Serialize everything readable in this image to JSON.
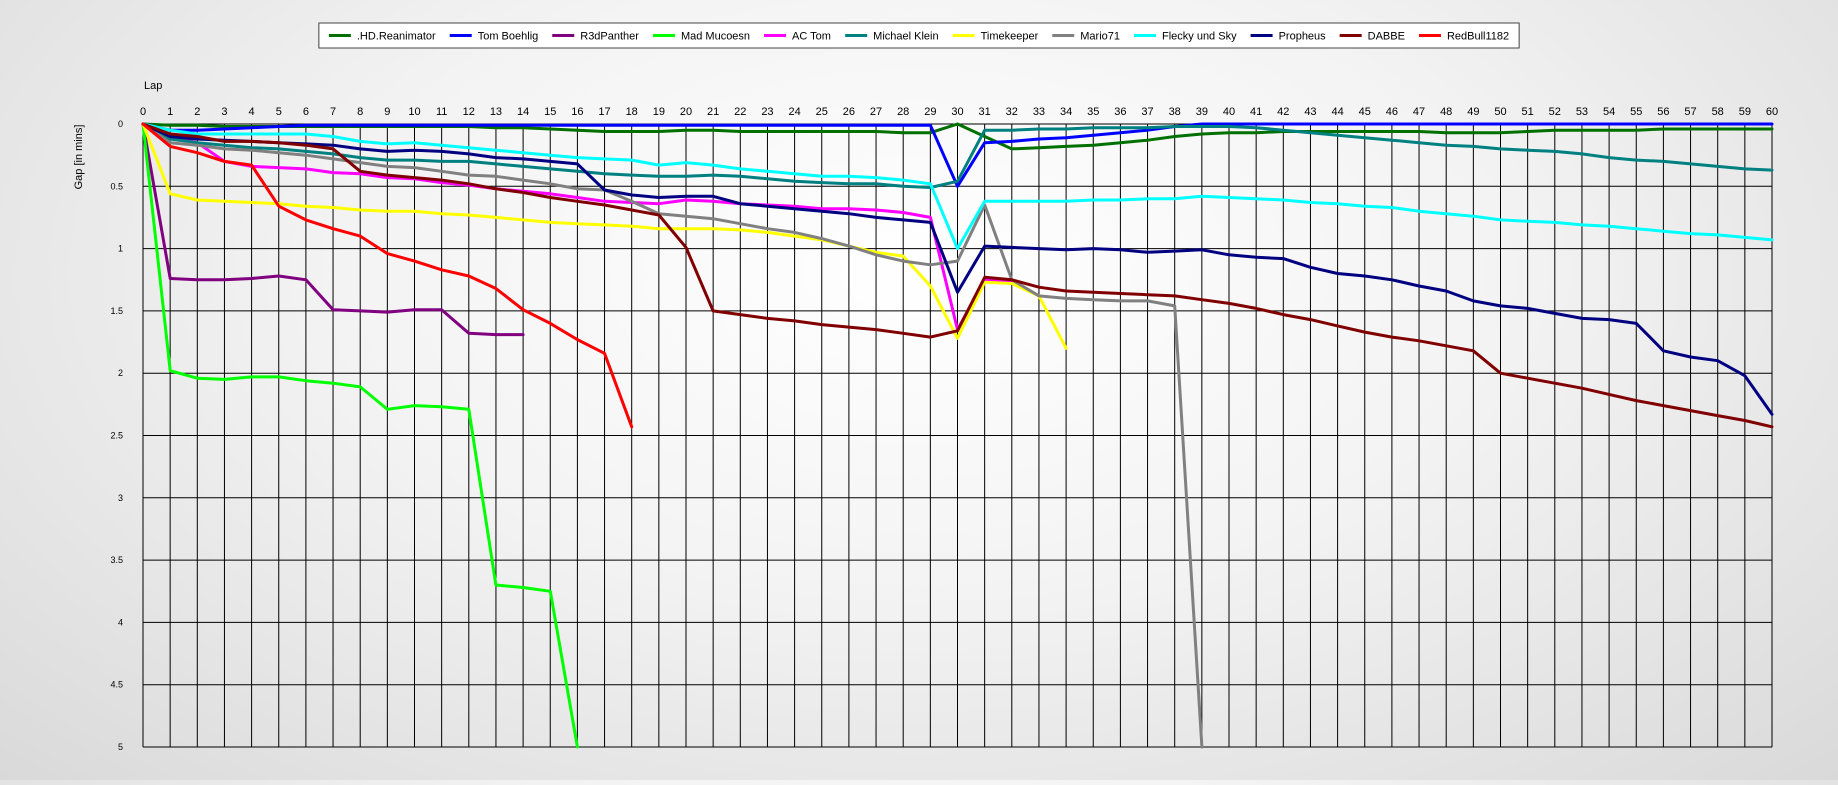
{
  "chart_data": {
    "type": "line",
    "title": "",
    "xlabel": "Lap",
    "ylabel": "Gap [in mins]",
    "x": [
      0,
      1,
      2,
      3,
      4,
      5,
      6,
      7,
      8,
      9,
      10,
      11,
      12,
      13,
      14,
      15,
      16,
      17,
      18,
      19,
      20,
      21,
      22,
      23,
      24,
      25,
      26,
      27,
      28,
      29,
      30,
      31,
      32,
      33,
      34,
      35,
      36,
      37,
      38,
      39,
      40,
      41,
      42,
      43,
      44,
      45,
      46,
      47,
      48,
      49,
      50,
      51,
      52,
      53,
      54,
      55,
      56,
      57,
      58,
      59,
      60
    ],
    "xlim": [
      0,
      60
    ],
    "ylim": [
      0,
      5
    ],
    "y_inverted": true,
    "yticks": [
      0,
      0.5,
      1,
      1.5,
      2,
      2.5,
      3,
      3.5,
      4,
      4.5,
      5
    ],
    "ytick_labels": [
      "0",
      "0.5",
      "1",
      "1.5",
      "2",
      "2.5",
      "3",
      "3.5",
      "4",
      "4.5",
      "5"
    ],
    "grid": true,
    "legend_position": "top-center",
    "series": [
      {
        "name": ".HD.Reanimator",
        "color": "#007000",
        "values": [
          0,
          0.01,
          0.01,
          0.02,
          0.02,
          0.02,
          0.02,
          0.02,
          0.02,
          0.02,
          0.02,
          0.02,
          0.02,
          0.03,
          0.03,
          0.04,
          0.05,
          0.06,
          0.06,
          0.06,
          0.05,
          0.05,
          0.06,
          0.06,
          0.06,
          0.06,
          0.06,
          0.06,
          0.07,
          0.07,
          0,
          0.1,
          0.2,
          0.19,
          0.18,
          0.17,
          0.15,
          0.13,
          0.1,
          0.08,
          0.07,
          0.07,
          0.06,
          0.06,
          0.06,
          0.06,
          0.06,
          0.06,
          0.07,
          0.07,
          0.07,
          0.06,
          0.05,
          0.05,
          0.05,
          0.05,
          0.04,
          0.04,
          0.04,
          0.04,
          0.04
        ]
      },
      {
        "name": "Tom Boehlig",
        "color": "#0000ff",
        "values": [
          0,
          0.05,
          0.05,
          0.04,
          0.03,
          0.02,
          0.01,
          0.01,
          0.01,
          0.01,
          0.01,
          0.01,
          0.01,
          0.01,
          0.01,
          0.01,
          0.01,
          0.01,
          0.01,
          0.01,
          0.01,
          0.01,
          0.01,
          0.01,
          0.01,
          0.01,
          0.01,
          0.01,
          0.01,
          0.01,
          0.5,
          0.15,
          0.14,
          0.12,
          0.11,
          0.09,
          0.07,
          0.05,
          0.02,
          0,
          0,
          0,
          0,
          0,
          0,
          0,
          0,
          0,
          0,
          0,
          0,
          0,
          0,
          0,
          0,
          0,
          0,
          0,
          0,
          0,
          0
        ]
      },
      {
        "name": "R3dPanther",
        "color": "#800080",
        "values": [
          0,
          1.24,
          1.25,
          1.25,
          1.24,
          1.22,
          1.25,
          1.49,
          1.5,
          1.51,
          1.49,
          1.49,
          1.68,
          1.69,
          1.69
        ]
      },
      {
        "name": "Mad Mucoesn",
        "color": "#00ff00",
        "values": [
          0,
          1.98,
          2.04,
          2.05,
          2.03,
          2.03,
          2.06,
          2.08,
          2.11,
          2.29,
          2.26,
          2.27,
          2.29,
          3.7,
          3.72,
          3.75,
          5
        ]
      },
      {
        "name": "AC Tom",
        "color": "#ff00ff",
        "values": [
          0,
          0.1,
          0.15,
          0.3,
          0.34,
          0.35,
          0.36,
          0.39,
          0.4,
          0.43,
          0.44,
          0.47,
          0.49,
          0.52,
          0.54,
          0.56,
          0.59,
          0.62,
          0.63,
          0.64,
          0.61,
          0.62,
          0.64,
          0.65,
          0.66,
          0.68,
          0.68,
          0.69,
          0.71,
          0.75,
          1.65,
          1.25,
          1.27
        ]
      },
      {
        "name": "Michael Klein",
        "color": "#008080",
        "values": [
          0,
          0.12,
          0.15,
          0.17,
          0.19,
          0.2,
          0.22,
          0.24,
          0.27,
          0.29,
          0.29,
          0.3,
          0.3,
          0.32,
          0.34,
          0.36,
          0.38,
          0.4,
          0.41,
          0.42,
          0.42,
          0.41,
          0.42,
          0.44,
          0.46,
          0.47,
          0.48,
          0.48,
          0.5,
          0.51,
          0.46,
          0.05,
          0.05,
          0.04,
          0.04,
          0.03,
          0.03,
          0.03,
          0.02,
          0.02,
          0.02,
          0.03,
          0.05,
          0.07,
          0.09,
          0.11,
          0.13,
          0.15,
          0.17,
          0.18,
          0.2,
          0.21,
          0.22,
          0.24,
          0.27,
          0.29,
          0.3,
          0.32,
          0.34,
          0.36,
          0.37
        ]
      },
      {
        "name": "Timekeeper",
        "color": "#ffff00",
        "values": [
          0,
          0.56,
          0.61,
          0.62,
          0.63,
          0.64,
          0.66,
          0.67,
          0.69,
          0.7,
          0.7,
          0.72,
          0.73,
          0.75,
          0.77,
          0.79,
          0.8,
          0.81,
          0.82,
          0.84,
          0.84,
          0.84,
          0.85,
          0.87,
          0.9,
          0.93,
          0.98,
          1.03,
          1.06,
          1.3,
          1.72,
          1.27,
          1.28,
          1.38,
          1.8
        ]
      },
      {
        "name": "Mario71",
        "color": "#808080",
        "values": [
          0,
          0.15,
          0.17,
          0.2,
          0.21,
          0.23,
          0.25,
          0.28,
          0.31,
          0.34,
          0.35,
          0.38,
          0.41,
          0.42,
          0.45,
          0.48,
          0.52,
          0.53,
          0.62,
          0.72,
          0.74,
          0.76,
          0.8,
          0.84,
          0.87,
          0.92,
          0.98,
          1.05,
          1.1,
          1.13,
          1.1,
          0.65,
          1.25,
          1.38,
          1.4,
          1.41,
          1.42,
          1.42,
          1.46,
          5
        ]
      },
      {
        "name": "Flecky und Sky",
        "color": "#00ffff",
        "values": [
          0,
          0.05,
          0.08,
          0.08,
          0.08,
          0.08,
          0.08,
          0.1,
          0.14,
          0.16,
          0.15,
          0.17,
          0.19,
          0.21,
          0.23,
          0.25,
          0.27,
          0.28,
          0.29,
          0.33,
          0.31,
          0.33,
          0.36,
          0.38,
          0.4,
          0.42,
          0.42,
          0.43,
          0.45,
          0.48,
          1,
          0.62,
          0.62,
          0.62,
          0.62,
          0.61,
          0.61,
          0.6,
          0.6,
          0.58,
          0.59,
          0.6,
          0.61,
          0.63,
          0.64,
          0.66,
          0.67,
          0.7,
          0.72,
          0.74,
          0.77,
          0.78,
          0.79,
          0.81,
          0.82,
          0.84,
          0.86,
          0.88,
          0.89,
          0.91,
          0.93
        ]
      },
      {
        "name": "Propheus",
        "color": "#000080",
        "values": [
          0,
          0.1,
          0.12,
          0.13,
          0.14,
          0.15,
          0.16,
          0.17,
          0.2,
          0.22,
          0.21,
          0.22,
          0.24,
          0.27,
          0.28,
          0.3,
          0.32,
          0.53,
          0.57,
          0.59,
          0.58,
          0.58,
          0.64,
          0.66,
          0.68,
          0.7,
          0.72,
          0.75,
          0.77,
          0.79,
          1.35,
          0.98,
          0.99,
          1,
          1.01,
          1,
          1.01,
          1.03,
          1.02,
          1.01,
          1.05,
          1.07,
          1.08,
          1.15,
          1.2,
          1.22,
          1.25,
          1.3,
          1.34,
          1.42,
          1.46,
          1.48,
          1.52,
          1.56,
          1.57,
          1.6,
          1.82,
          1.87,
          1.9,
          2.02,
          2.33
        ]
      },
      {
        "name": "DABBE",
        "color": "#800000",
        "values": [
          0,
          0.08,
          0.1,
          0.14,
          0.14,
          0.15,
          0.17,
          0.2,
          0.38,
          0.41,
          0.43,
          0.45,
          0.48,
          0.52,
          0.55,
          0.59,
          0.62,
          0.65,
          0.69,
          0.73,
          0.99,
          1.5,
          1.53,
          1.56,
          1.58,
          1.61,
          1.63,
          1.65,
          1.68,
          1.71,
          1.66,
          1.23,
          1.25,
          1.31,
          1.34,
          1.35,
          1.36,
          1.37,
          1.38,
          1.41,
          1.44,
          1.48,
          1.53,
          1.57,
          1.62,
          1.67,
          1.71,
          1.74,
          1.78,
          1.82,
          2,
          2.04,
          2.08,
          2.12,
          2.17,
          2.22,
          2.26,
          2.3,
          2.34,
          2.38,
          2.43
        ]
      },
      {
        "name": "RedBull1182",
        "color": "#ff0000",
        "values": [
          0,
          0.18,
          0.23,
          0.3,
          0.33,
          0.66,
          0.77,
          0.84,
          0.9,
          1.04,
          1.1,
          1.17,
          1.22,
          1.32,
          1.49,
          1.6,
          1.73,
          1.84,
          2.43
        ]
      }
    ]
  }
}
